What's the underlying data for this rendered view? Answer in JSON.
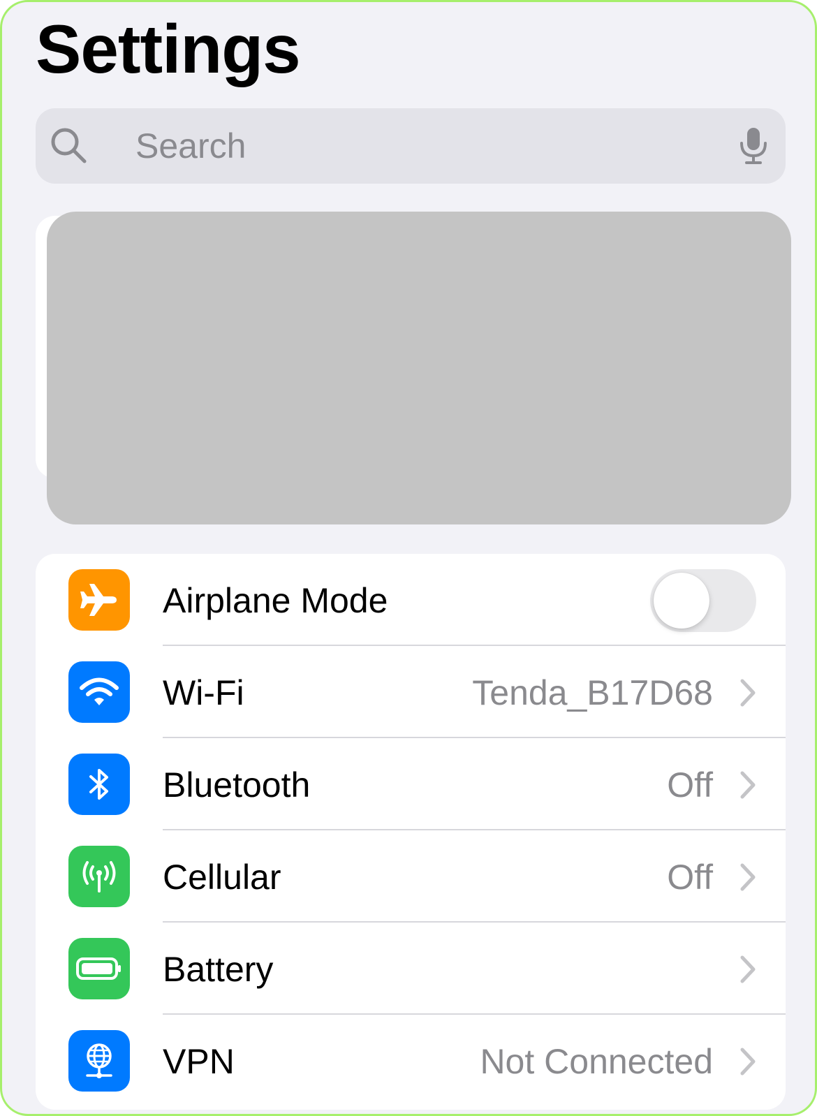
{
  "header": {
    "title": "Settings"
  },
  "search": {
    "placeholder": "Search",
    "search_icon": "magnifier-icon",
    "mic_icon": "microphone-icon"
  },
  "connectivity": {
    "rows": [
      {
        "label": "Airplane Mode",
        "icon": "airplane-icon",
        "icon_color": "#ff9500",
        "control": "toggle",
        "toggle_on": false
      },
      {
        "label": "Wi-Fi",
        "value": "Tenda_B17D68",
        "icon": "wifi-icon",
        "icon_color": "#007aff"
      },
      {
        "label": "Bluetooth",
        "value": "Off",
        "icon": "bluetooth-icon",
        "icon_color": "#007aff"
      },
      {
        "label": "Cellular",
        "value": "Off",
        "icon": "antenna-icon",
        "icon_color": "#34c759"
      },
      {
        "label": "Battery",
        "value": "",
        "icon": "battery-icon",
        "icon_color": "#34c759"
      },
      {
        "label": "VPN",
        "value": "Not Connected",
        "icon": "globe-icon",
        "icon_color": "#007aff"
      }
    ]
  },
  "colors": {
    "background": "#f2f2f7",
    "frame_border": "#a6ef6c",
    "redaction": "#c4c4c4"
  }
}
